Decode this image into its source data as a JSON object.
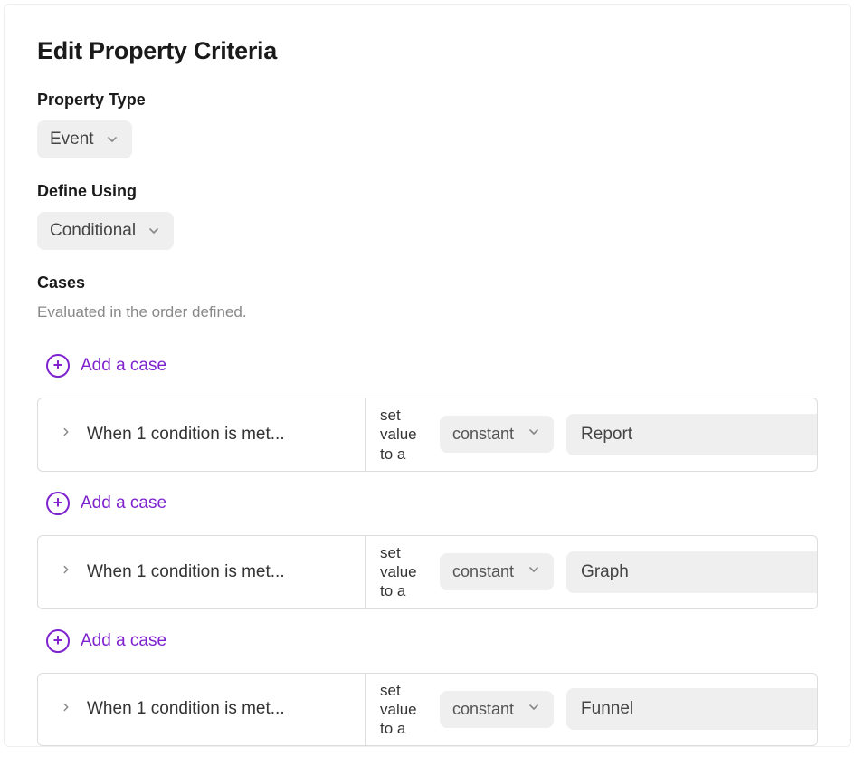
{
  "title": "Edit Property Criteria",
  "propertyType": {
    "label": "Property Type",
    "value": "Event"
  },
  "defineUsing": {
    "label": "Define Using",
    "value": "Conditional"
  },
  "casesSection": {
    "label": "Cases",
    "subtext": "Evaluated in the order defined."
  },
  "addCaseLabel": "Add a case",
  "caseConditionText": "When 1 condition is met...",
  "setValueText": "set value to a",
  "constantLabel": "constant",
  "cases": [
    {
      "value": "Report"
    },
    {
      "value": "Graph"
    },
    {
      "value": "Funnel"
    }
  ]
}
